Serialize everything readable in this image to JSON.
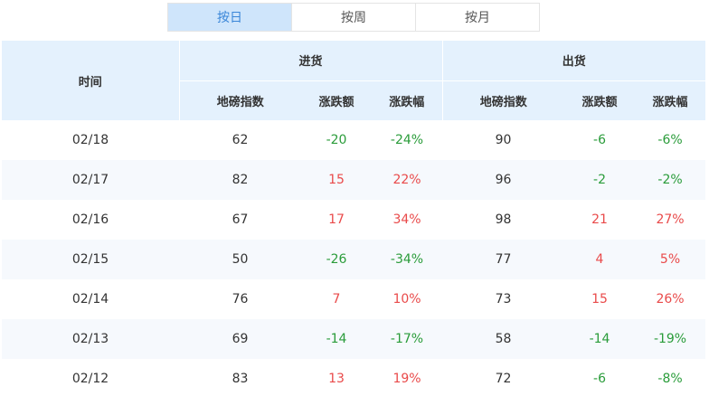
{
  "tabs": [
    {
      "label": "按日",
      "active": true
    },
    {
      "label": "按周",
      "active": false
    },
    {
      "label": "按月",
      "active": false
    }
  ],
  "table": {
    "time_header": "时间",
    "groups": [
      "进货",
      "出货"
    ],
    "sub_headers": [
      "地磅指数",
      "涨跌额",
      "涨跌幅"
    ],
    "rows": [
      {
        "date": "02/18",
        "in": [
          "62",
          "-20",
          "-24%"
        ],
        "out": [
          "90",
          "-6",
          "-6%"
        ]
      },
      {
        "date": "02/17",
        "in": [
          "82",
          "15",
          "22%"
        ],
        "out": [
          "96",
          "-2",
          "-2%"
        ]
      },
      {
        "date": "02/16",
        "in": [
          "67",
          "17",
          "34%"
        ],
        "out": [
          "98",
          "21",
          "27%"
        ]
      },
      {
        "date": "02/15",
        "in": [
          "50",
          "-26",
          "-34%"
        ],
        "out": [
          "77",
          "4",
          "5%"
        ]
      },
      {
        "date": "02/14",
        "in": [
          "76",
          "7",
          "10%"
        ],
        "out": [
          "73",
          "15",
          "26%"
        ]
      },
      {
        "date": "02/13",
        "in": [
          "69",
          "-14",
          "-17%"
        ],
        "out": [
          "58",
          "-14",
          "-19%"
        ]
      },
      {
        "date": "02/12",
        "in": [
          "83",
          "13",
          "19%"
        ],
        "out": [
          "72",
          "-6",
          "-8%"
        ]
      }
    ]
  },
  "colors": {
    "up": "#e94a4a",
    "down": "#2a9c3a",
    "accent": "#3a86d8",
    "header_bg": "#e4f1fd"
  }
}
